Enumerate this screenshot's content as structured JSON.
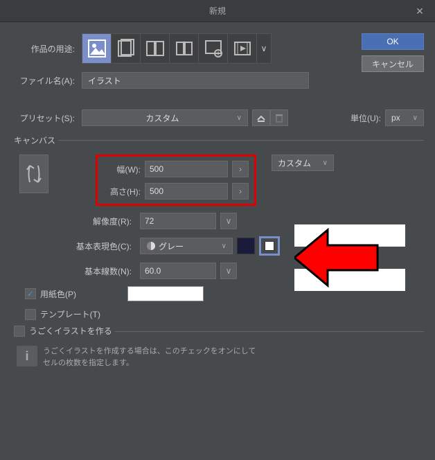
{
  "title": "新規",
  "buttons": {
    "ok": "OK",
    "cancel": "キャンセル"
  },
  "labels": {
    "purpose": "作品の用途:",
    "filename": "ファイル名(A):",
    "preset": "プリセット(S):",
    "unit": "単位(U):",
    "canvas": "キャンバス",
    "width": "幅(W):",
    "height": "高さ(H):",
    "resolution": "解像度(R):",
    "basecolor": "基本表現色(C):",
    "lines": "基本線数(N):",
    "papercolor": "用紙色(P)",
    "template": "テンプレート(T)",
    "moving": "うごくイラストを作る",
    "info": "うごくイラストを作成する場合は、このチェックをオンにして\nセルの枚数を指定します。"
  },
  "values": {
    "filename": "イラスト",
    "preset": "カスタム",
    "unit": "px",
    "width": "500",
    "height": "500",
    "resolution": "72",
    "basecolor": "グレー",
    "lines": "60.0",
    "size_preset": "カスタム"
  },
  "icons": {
    "close": "✕",
    "chevron": "∨",
    "spin": "›",
    "check": "✓",
    "info": "i"
  }
}
